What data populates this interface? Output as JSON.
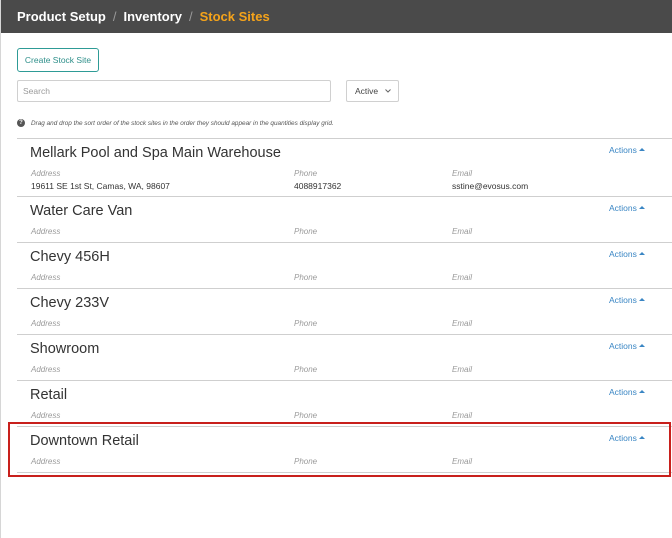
{
  "breadcrumb": {
    "items": [
      {
        "label": "Product Setup"
      },
      {
        "label": "Inventory"
      },
      {
        "label": "Stock Sites"
      }
    ],
    "separator": "/"
  },
  "toolbar": {
    "create_label": "Create Stock Site",
    "search_placeholder": "Search",
    "status_value": "Active"
  },
  "hint_text": "Drag and drop the sort order of the stock sites in the order they should appear in the quantities display grid.",
  "field_labels": {
    "address": "Address",
    "phone": "Phone",
    "email": "Email"
  },
  "actions_label": "Actions",
  "sites": [
    {
      "name": "Mellark Pool and Spa Main Warehouse",
      "address": "19611 SE 1st St, Camas, WA, 98607",
      "phone": "4088917362",
      "email": "sstine@evosus.com"
    },
    {
      "name": "Water Care Van",
      "address": "",
      "phone": "",
      "email": ""
    },
    {
      "name": "Chevy 456H",
      "address": "",
      "phone": "",
      "email": ""
    },
    {
      "name": "Chevy 233V",
      "address": "",
      "phone": "",
      "email": ""
    },
    {
      "name": "Showroom",
      "address": "",
      "phone": "",
      "email": ""
    },
    {
      "name": "Retail",
      "address": "",
      "phone": "",
      "email": ""
    },
    {
      "name": "Downtown Retail",
      "address": "",
      "phone": "",
      "email": ""
    }
  ],
  "colors": {
    "topbar": "#4a4a4a",
    "breadcrumb_active": "#f5a31a",
    "link": "#3a86c4",
    "button_border": "#2e9b96",
    "highlight": "#c8201c"
  }
}
